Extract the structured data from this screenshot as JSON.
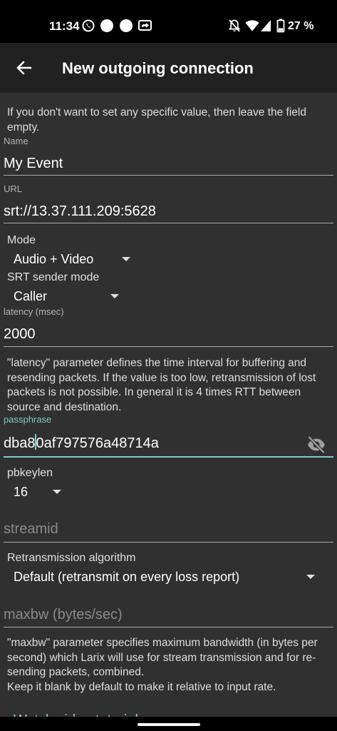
{
  "status_bar": {
    "time": "11:34",
    "battery_percent": "27 %",
    "left_icons": [
      "whatsapp-icon",
      "notification-dot-icon",
      "notification-dot-icon",
      "cast-icon"
    ],
    "right_icons": [
      "bell-off-icon",
      "wifi-icon",
      "signal-icon",
      "battery-icon"
    ]
  },
  "app_bar": {
    "back_icon": "arrow-back-icon",
    "title": "New outgoing connection"
  },
  "form": {
    "intro_hint": "If you don't want to set any specific value, then leave the field empty.",
    "name": {
      "label": "Name",
      "value": "My Event"
    },
    "url": {
      "label": "URL",
      "value": "srt://13.37.111.209:5628"
    },
    "mode": {
      "label": "Mode",
      "value": "Audio + Video"
    },
    "srt_sender_mode": {
      "label": "SRT sender mode",
      "value": "Caller"
    },
    "latency": {
      "label": "latency (msec)",
      "value": "2000",
      "hint": "\"latency\" parameter defines the time interval for buffering and resending packets. If the value is too low, retransmission of lost packets is not possible. In general it is 4 times RTT between source and destination."
    },
    "passphrase": {
      "label": "passphrase",
      "value_before_cursor": "dba8",
      "value_after_cursor": "0af797576a48714a",
      "toggle_icon": "eye-off-icon",
      "focused": true
    },
    "pbkeylen": {
      "label": "pbkeylen",
      "value": "16"
    },
    "streamid": {
      "placeholder": "streamid",
      "value": ""
    },
    "retransmission_algorithm": {
      "label": "Retransmission algorithm",
      "value": "Default (retransmit on every loss report)"
    },
    "maxbw": {
      "placeholder": "maxbw (bytes/sec)",
      "value": "",
      "hint_line1": "\"maxbw\" parameter specifies maximum bandwidth (in bytes per second) which Larix will use for stream transmission and for re-sending packets, combined.",
      "hint_line2": "Keep it blank by default to make it relative to input rate."
    },
    "watch_video_link": "Watch video tutorial"
  },
  "colors": {
    "accent": "#80cbc4",
    "background": "#303030",
    "app_bar": "#212121",
    "status_bar": "#000000"
  }
}
